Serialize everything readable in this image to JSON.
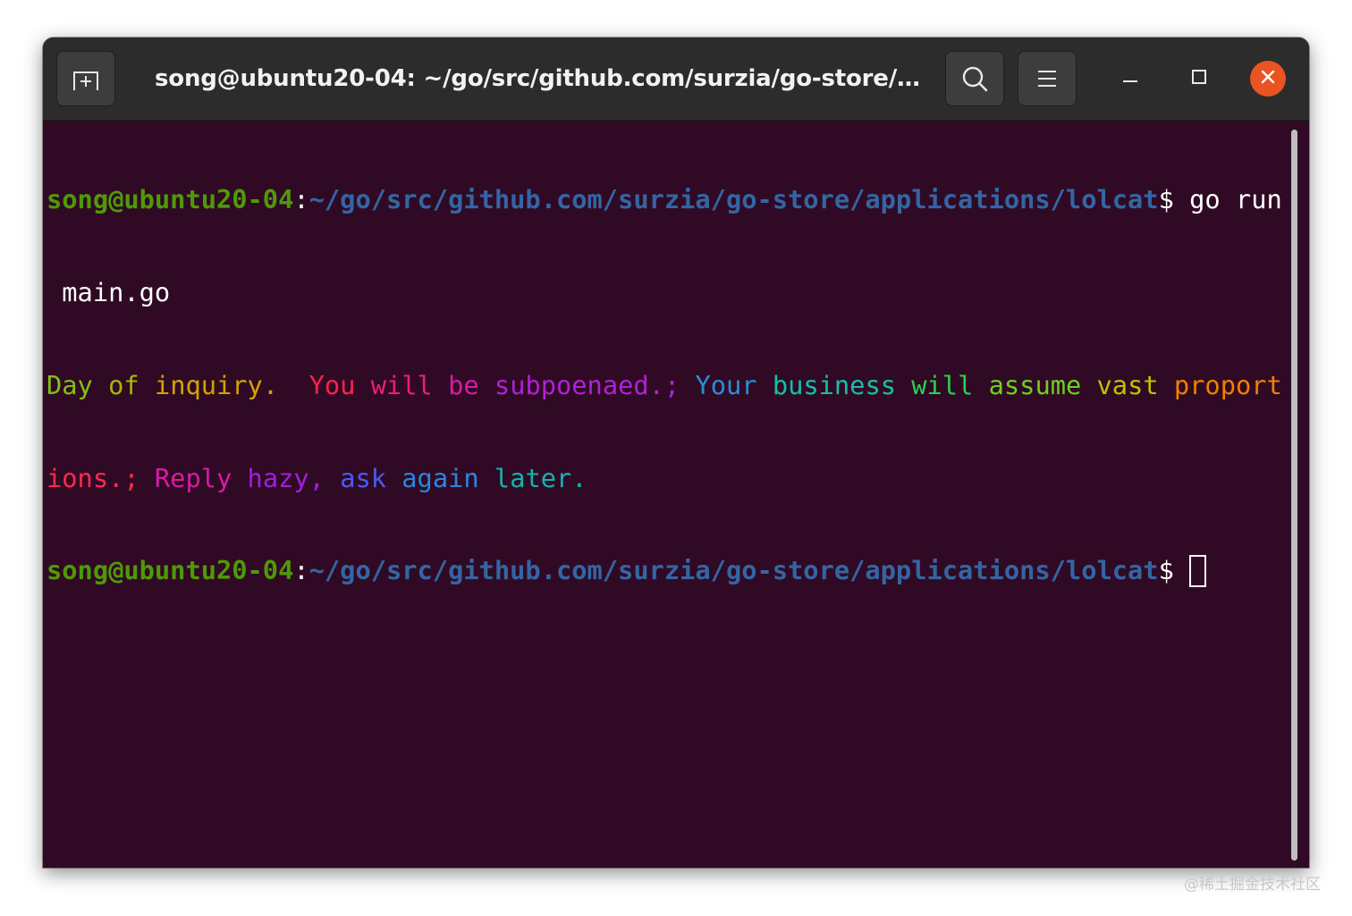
{
  "window": {
    "title": "song@ubuntu20-04: ~/go/src/github.com/surzia/go-store/ap..."
  },
  "icons": {
    "new_tab": "new-tab-icon",
    "search": "search-icon",
    "menu": "hamburger-menu-icon",
    "minimize": "minimize-icon",
    "maximize": "maximize-icon",
    "close": "close-icon"
  },
  "colors": {
    "terminal_background": "#300a24",
    "titlebar_background": "#2c2c2c",
    "prompt_user": "#4e9a06",
    "prompt_path": "#3465a4",
    "close_button": "#e95420",
    "foreground": "#ffffff"
  },
  "terminal": {
    "prompt": {
      "user_host": "song@ubuntu20-04",
      "separator": ":",
      "path": "~/go/src/github.com/surzia/go-store/applications/lolcat",
      "symbol": "$"
    },
    "command_line1": " go run",
    "command_line2": " main.go",
    "output_line1": [
      {
        "text": "Day ",
        "color": "#85c010"
      },
      {
        "text": "of ",
        "color": "#a6b800"
      },
      {
        "text": "inquiry.",
        "color": "#d0a400"
      },
      {
        "text": "  ",
        "color": "#ffffff"
      },
      {
        "text": "You ",
        "color": "#ff2050"
      },
      {
        "text": "will ",
        "color": "#f01c78"
      },
      {
        "text": "be ",
        "color": "#d81aa8"
      },
      {
        "text": "subpoenaed.; ",
        "color": "#b020d8"
      },
      {
        "text": "Your ",
        "color": "#2a8ed8"
      },
      {
        "text": "business ",
        "color": "#14c0a8"
      },
      {
        "text": "will ",
        "color": "#2ad050"
      },
      {
        "text": "assume ",
        "color": "#6ed020"
      },
      {
        "text": "vast ",
        "color": "#bcc400"
      },
      {
        "text": "proport",
        "color": "#f08000"
      }
    ],
    "output_line2": [
      {
        "text": "ions.; ",
        "color": "#ff2a50"
      },
      {
        "text": "Reply ",
        "color": "#d81aa8"
      },
      {
        "text": "hazy, ",
        "color": "#a01ee0"
      },
      {
        "text": "ask ",
        "color": "#4a5cf0"
      },
      {
        "text": "again ",
        "color": "#2a86e0"
      },
      {
        "text": "later.",
        "color": "#14b4b0"
      }
    ],
    "second_prompt_trailing": " "
  },
  "watermark": "@稀土掘金技术社区"
}
